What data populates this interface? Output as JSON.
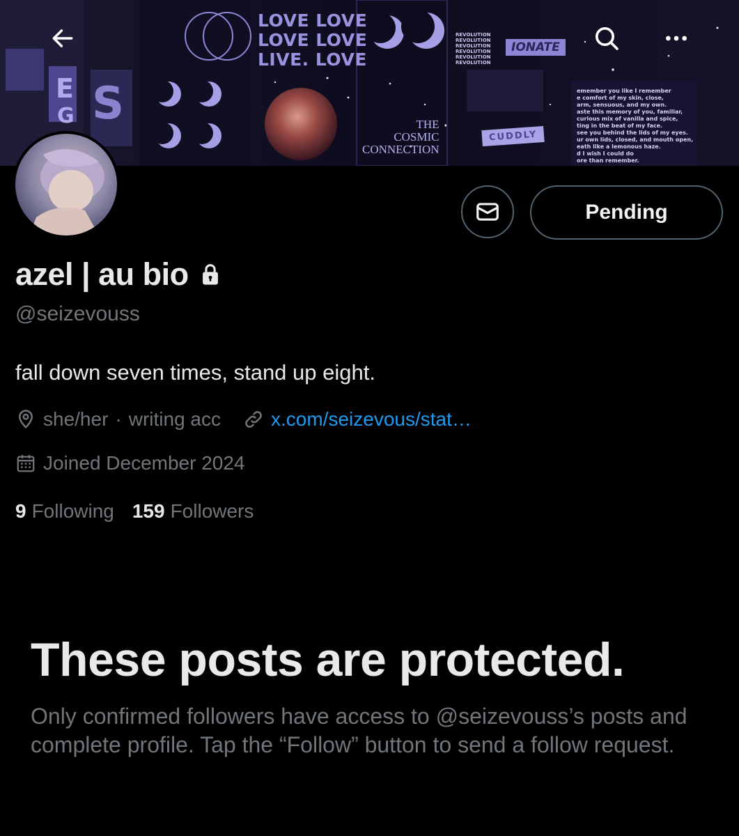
{
  "banner": {
    "love_lines": [
      "LOVE LOVE",
      "LOVE LOVE",
      "LIVE. LOVE"
    ],
    "cosmic_lines": [
      "THE",
      "COSMIC",
      "CONNECTION"
    ],
    "cuddly": "CUDDLY",
    "onate": "IONATE",
    "revolution_lines": [
      "REVOLUTION",
      "REVOLUTION",
      "REVOLUTION",
      "REVOLUTION",
      "REVOLUTION",
      "REVOLUTION"
    ],
    "poem_lines": [
      "emember you like I remember",
      "e comfort of my skin, close,",
      "arm, sensuous, and my own.",
      "aste this memory of you, familiar,",
      "curious mix of vanilla and spice,",
      "ting in the beat of my face.",
      "see you behind the lids of my eyes.",
      "ur own lids, closed, and mouth open,",
      "eath like a lemonous haze.",
      "d I wish I could do",
      "ore than remember."
    ],
    "accent_color": "#8f87d8"
  },
  "nav": {
    "back_icon": "arrow-left-icon",
    "search_icon": "search-icon",
    "more_icon": "more-horizontal-icon"
  },
  "profile": {
    "display_name": "azel | au bio",
    "handle": "@seizevouss",
    "bio": "fall down seven times, stand up eight.",
    "location": "she/her",
    "location_extra": "writing acc",
    "separator": "·",
    "link": "x.com/seizevous/stat…",
    "joined": "Joined December 2024",
    "following_count": "9",
    "following_label": "Following",
    "followers_count": "159",
    "followers_label": "Followers"
  },
  "actions": {
    "message_icon": "envelope-icon",
    "pending_label": "Pending"
  },
  "protected": {
    "title": "These posts are protected.",
    "description": "Only confirmed followers have access to @seizevouss’s posts and complete profile. Tap the “Follow” button to send a follow request."
  },
  "colors": {
    "background": "#000000",
    "text_primary": "#e7e9ea",
    "text_secondary": "#71767b",
    "link": "#1d9bf0",
    "border": "#536471"
  }
}
